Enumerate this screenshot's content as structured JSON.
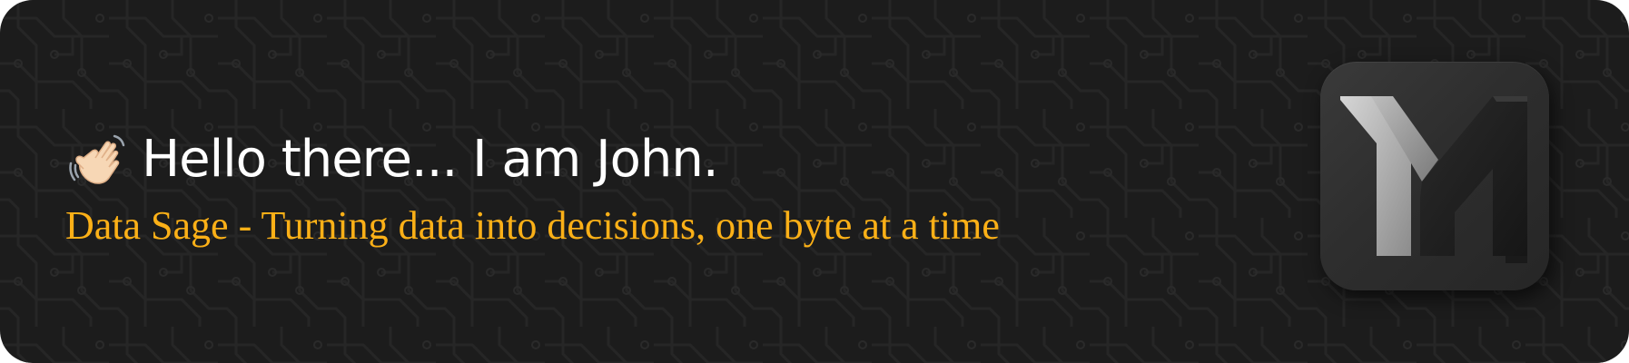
{
  "greeting": {
    "wave_icon": "waving-hand-icon",
    "text": "Hello there... I am John."
  },
  "tagline": {
    "text": "Data Sage - Turning data into decisions, one byte at a time"
  },
  "logo": {
    "icon": "m-logo-icon"
  },
  "colors": {
    "background": "#1c1c1c",
    "greeting": "#ffffff",
    "tagline": "#fbb017",
    "tile": "#2e2e2e"
  }
}
